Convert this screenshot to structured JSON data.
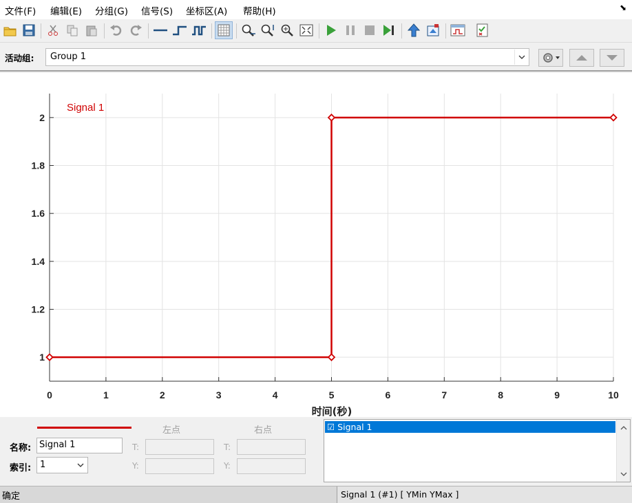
{
  "menu": {
    "items": [
      "文件(F)",
      "编辑(E)",
      "分组(G)",
      "信号(S)",
      "坐标区(A)",
      "帮助(H)"
    ],
    "close_glyph": "⬊"
  },
  "toolbar": {
    "buttons": [
      "open-icon",
      "save-icon",
      "cut-icon",
      "copy-icon",
      "paste-icon",
      "undo-icon",
      "redo-icon",
      "constant-signal-icon",
      "step-signal-icon",
      "pulse-signal-icon",
      "grid-icon",
      "zoom-x-icon",
      "zoom-y-icon",
      "zoom-icon",
      "fit-view-icon",
      "run-icon",
      "pause-icon",
      "stop-icon",
      "step-forward-icon",
      "update-icon",
      "export-icon",
      "show-signal-icon",
      "requirements-icon"
    ]
  },
  "group_bar": {
    "label": "活动组:",
    "selected": "Group 1"
  },
  "chart_data": {
    "type": "line",
    "x": [
      0,
      5,
      5,
      10
    ],
    "series": [
      {
        "name": "Signal 1",
        "values": [
          1,
          1,
          2,
          2
        ],
        "color": "#d00000"
      }
    ],
    "points": [
      {
        "x": 0,
        "y": 1
      },
      {
        "x": 5,
        "y": 1
      },
      {
        "x": 5,
        "y": 2
      },
      {
        "x": 10,
        "y": 2
      }
    ],
    "xlabel": "时间(秒)",
    "ylabel": "",
    "xlim": [
      0,
      10
    ],
    "ylim": [
      0.9,
      2.1
    ],
    "xticks": [
      0,
      1,
      2,
      3,
      4,
      5,
      6,
      7,
      8,
      9,
      10
    ],
    "yticks": [
      1,
      1.2,
      1.4,
      1.6,
      1.8,
      2
    ],
    "ytick_labels": [
      "1",
      "1.2",
      "1.4",
      "1.6",
      "1.8",
      "2"
    ],
    "legend_label": "Signal 1",
    "legend_position": "top-left",
    "grid": true
  },
  "bottom": {
    "left_point": "左点",
    "right_point": "右点",
    "name_label": "名称:",
    "name_value": "Signal 1",
    "index_label": "索引:",
    "index_value": "1",
    "t_label": "T:",
    "y_label": "Y:",
    "signal_list_item": "☑ Signal 1"
  },
  "status": {
    "left": "确定",
    "right": "Signal 1 (#1)  [ YMin YMax ]"
  },
  "colors": {
    "signal": "#d00000",
    "selection": "#0078d7"
  }
}
